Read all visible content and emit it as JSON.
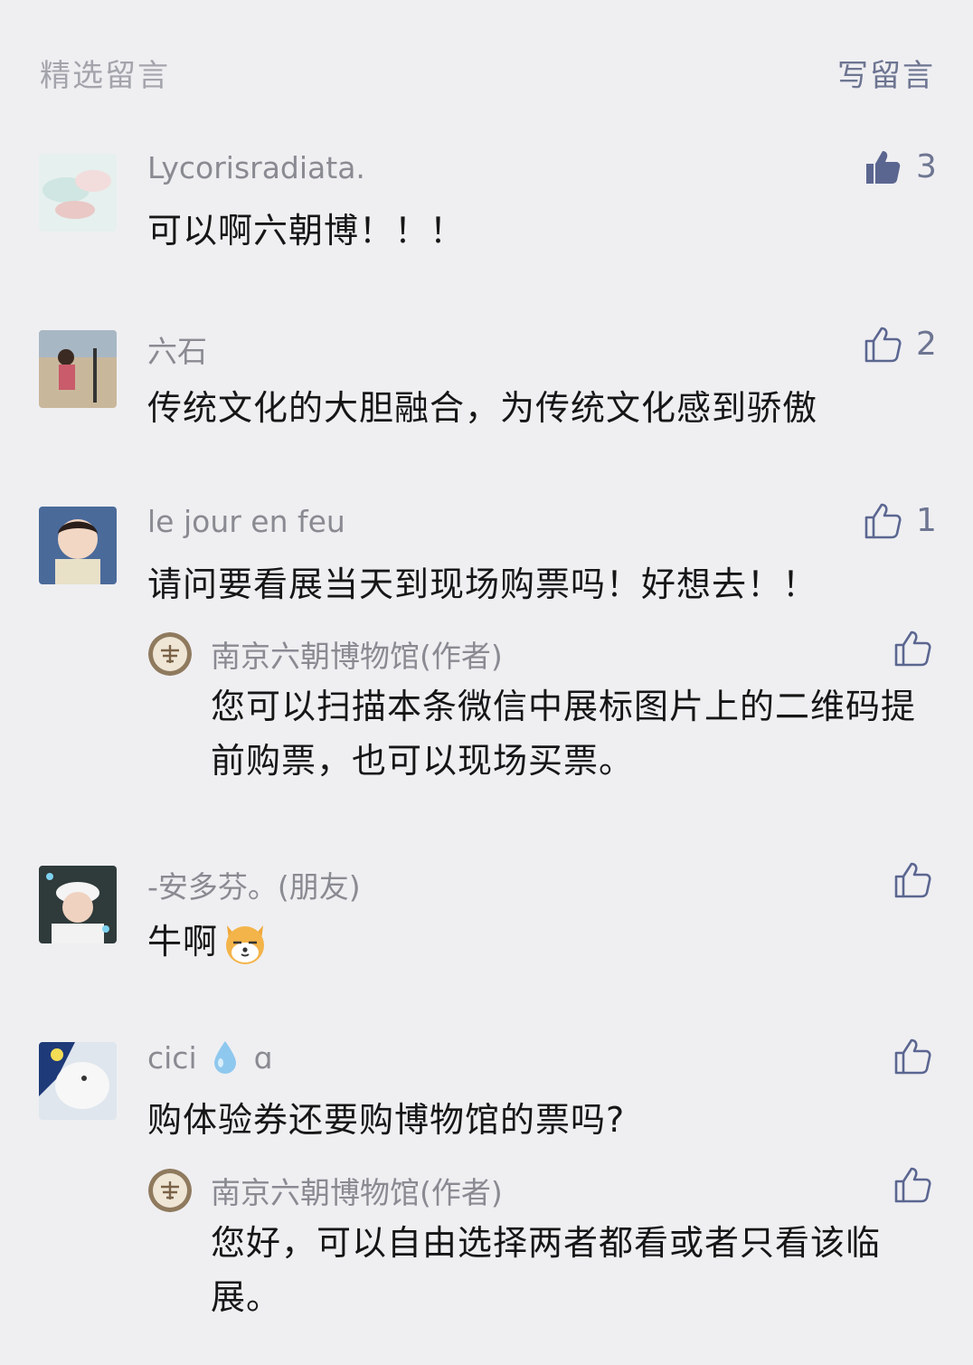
{
  "header": {
    "title": "精选留言",
    "write_label": "写留言"
  },
  "comments": [
    {
      "nickname": "Lycorisradiata.",
      "content": "可以啊六朝博！！！",
      "likes": "3",
      "liked": true
    },
    {
      "nickname": "六石",
      "content": "传统文化的大胆融合，为传统文化感到骄傲",
      "likes": "2",
      "liked": false
    },
    {
      "nickname": "le jour en feu",
      "content": "请问要看展当天到现场购票吗！好想去！！",
      "likes": "1",
      "liked": false,
      "reply": {
        "nickname": "南京六朝博物馆(作者)",
        "content": "您可以扫描本条微信中展标图片上的二维码提前购票，也可以现场买票。"
      }
    },
    {
      "nickname": "-安多芬。(朋友)",
      "content": "牛啊",
      "emoji": "dog-emoji",
      "likes": "",
      "liked": false
    },
    {
      "nickname_prefix": "cici",
      "nickname_suffix": "ɑ",
      "nickname_icon": "water-drop-icon",
      "content": "购体验券还要购博物馆的票吗?",
      "likes": "",
      "liked": false,
      "reply": {
        "nickname": "南京六朝博物馆(作者)",
        "content": "您好，可以自由选择两者都看或者只看该临展。"
      }
    }
  ],
  "colors": {
    "background": "#efeff2",
    "link": "#6d7591",
    "nickname": "#8a8a92",
    "text": "#161616"
  }
}
